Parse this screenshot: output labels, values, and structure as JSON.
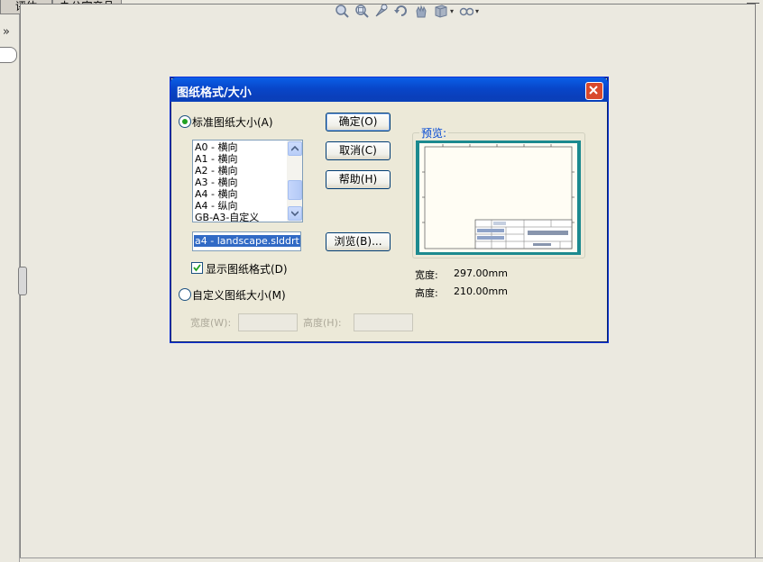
{
  "tabs": [
    "评估",
    "办公室产品"
  ],
  "dialog": {
    "title": "图纸格式/大小",
    "standard_size_label": "标准图纸大小(A)",
    "paper_sizes": [
      "A0 - 横向",
      "A1 - 横向",
      "A2 - 横向",
      "A3 - 横向",
      "A4 - 横向",
      "A4 - 纵向",
      "GB-A3-自定义"
    ],
    "template_value": "a4 - landscape.slddrt",
    "show_format_label": "显示图纸格式(D)",
    "show_format_checked": true,
    "custom_size_label": "自定义图纸大小(M)",
    "width_label": "宽度(W):",
    "height_label": "高度(H):",
    "buttons": {
      "ok": "确定(O)",
      "cancel": "取消(C)",
      "help": "帮助(H)",
      "browse": "浏览(B)..."
    },
    "preview_label": "预览:",
    "preview_dims": {
      "width_label": "宽度:",
      "width_value": "297.00mm",
      "height_label": "高度:",
      "height_value": "210.00mm"
    }
  },
  "icons": [
    "zoom-to-fit-icon",
    "zoom-area-icon",
    "zoom-select-icon",
    "rotate-icon",
    "pan-icon",
    "display-style-icon",
    "view-settings-icon"
  ],
  "colors": {
    "title_bar": "#0a4ed0",
    "selection": "#316ac5",
    "preview_frame": "#1c8a8f",
    "close_button": "#d9492c"
  }
}
